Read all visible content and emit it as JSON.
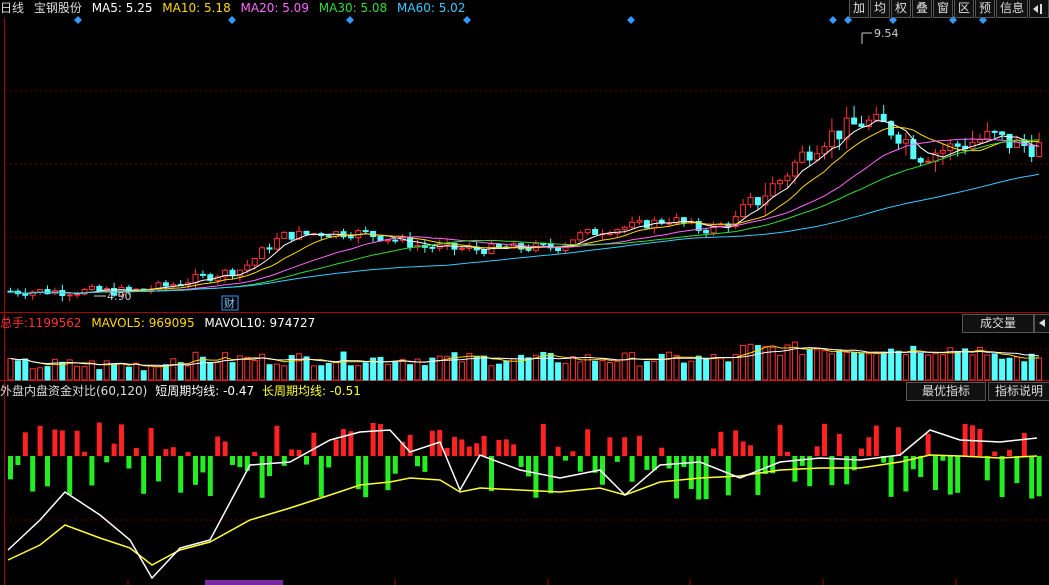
{
  "header": {
    "period": "日线",
    "stock_name": "宝钢股份",
    "ma": [
      {
        "label": "MA5: 5.25",
        "color": "#ffffff"
      },
      {
        "label": "MA10: 5.18",
        "color": "#ffd700"
      },
      {
        "label": "MA20: 5.09",
        "color": "#ff66ff"
      },
      {
        "label": "MA30: 5.08",
        "color": "#33dd33"
      },
      {
        "label": "MA60: 5.02",
        "color": "#33ccff"
      }
    ]
  },
  "toolbar": [
    "加",
    "均",
    "权",
    "叠",
    "窗",
    "区",
    "预",
    "信息",
    "exit-icon"
  ],
  "price_chart": {
    "high_label": "9.54",
    "low_label": "4.90",
    "event_marker": "财",
    "marker_color": "#3399ff",
    "up_color": "#ff3333",
    "down_color": "#55ffff"
  },
  "volume": {
    "total_label": "总手:",
    "total_value": "1199562",
    "mavol5_label": "MAVOL5:",
    "mavol5_value": "969095",
    "mavol10_label": "MAVOL10:",
    "mavol10_value": "974727",
    "selector": "成交量"
  },
  "indicator": {
    "name": "外盘内盘资金对比(60,120)",
    "short_label": "短周期均线:",
    "short_value": "-0.47",
    "long_label": "长周期均线:",
    "long_value": "-0.51",
    "best_button": "最优指标",
    "help_button": "指标说明"
  }
}
